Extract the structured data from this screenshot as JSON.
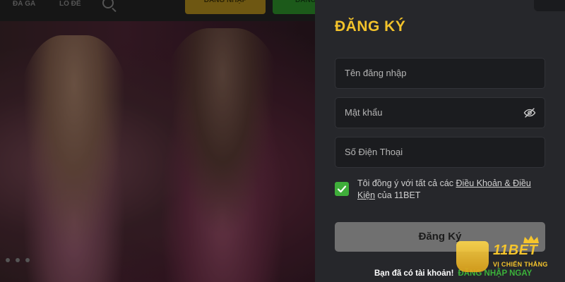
{
  "topbar": {
    "nav_item_1": "ĐÁ GÀ",
    "nav_item_2": "LÔ ĐỀ",
    "login_button": "ĐĂNG NHẬP",
    "register_button": "ĐĂNG"
  },
  "register": {
    "title": "ĐĂNG KÝ",
    "username_placeholder": "Tên đăng nhập",
    "password_placeholder": "Mật khẩu",
    "phone_placeholder": "Số Điện Thoại",
    "agree_prefix": "Tôi đồng ý với tất cả các ",
    "agree_link": "Điều Khoản & Điều Kiện",
    "agree_suffix": " của 11BET",
    "agree_checked": true,
    "submit_label": "Đăng Ký",
    "have_account": "Bạn đã có tài khoản!",
    "login_now": "ĐĂNG NHẬP NGAY"
  },
  "brand": {
    "name": "11BET",
    "tagline": "VỊ CHIẾN THẮNG"
  },
  "colors": {
    "accent_gold": "#f3c32b",
    "accent_green": "#3fae3a",
    "panel_bg": "#26272b"
  },
  "icons": [
    "search-icon",
    "close-icon",
    "eye-slash-icon",
    "check-icon",
    "crown-icon"
  ]
}
